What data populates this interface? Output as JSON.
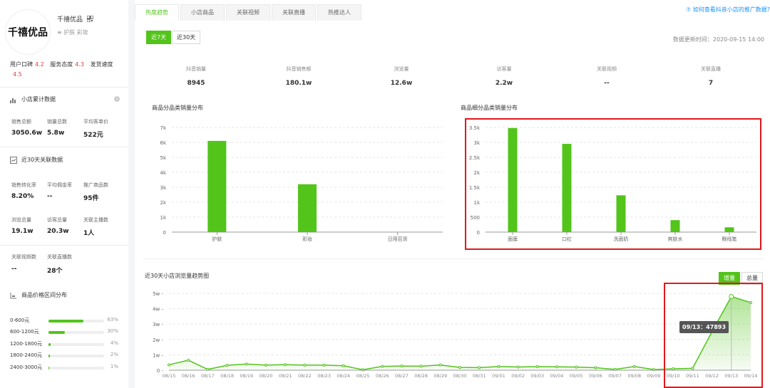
{
  "shop": {
    "avatar_text": "千禧优品",
    "name": "千禧优品",
    "categories": "护肤 彩妆",
    "ratings": [
      {
        "label": "用户口碑",
        "value": "4.2"
      },
      {
        "label": "服务态度",
        "value": "4.3"
      },
      {
        "label": "发货速度",
        "value": "4.5"
      }
    ]
  },
  "cumulative": {
    "title": "小店累计数据",
    "stats": [
      {
        "label": "销售总额",
        "value": "3050.6w"
      },
      {
        "label": "销量总数",
        "value": "5.8w"
      },
      {
        "label": "平均客单价",
        "value": "522元"
      }
    ]
  },
  "recent30": {
    "title": "近30天关联数据",
    "stats": [
      {
        "label": "销售转化率",
        "value": "8.20%"
      },
      {
        "label": "平均佣金率",
        "value": "--"
      },
      {
        "label": "推广商品数",
        "value": "95件"
      },
      {
        "label": "浏览总量",
        "value": "19.1w"
      },
      {
        "label": "访客总量",
        "value": "20.3w"
      },
      {
        "label": "关联主播数",
        "value": "1人"
      },
      {
        "label": "关联视频数",
        "value": "--"
      },
      {
        "label": "关联直播数",
        "value": "28个"
      }
    ]
  },
  "price_dist": {
    "title": "商品价格区间分布",
    "rows": [
      {
        "label": "0-600元",
        "pct_text": "63%",
        "fraction": 0.63
      },
      {
        "label": "600-1200元",
        "pct_text": "30%",
        "fraction": 0.3
      },
      {
        "label": "1200-1800元",
        "pct_text": "4%",
        "fraction": 0.04
      },
      {
        "label": "1800-2400元",
        "pct_text": "2%",
        "fraction": 0.02
      },
      {
        "label": "2400-3000元",
        "pct_text": "1%",
        "fraction": 0.01
      }
    ]
  },
  "tabs": [
    "热度趋势",
    "小店商品",
    "关联视频",
    "关联直播",
    "热推达人"
  ],
  "help_link": "⑦ 如何查看抖音小店的推广数据?",
  "range_buttons": [
    "近7天",
    "近30天"
  ],
  "update_time": "数据更新时间：2020-09-15 14:00",
  "kpis": [
    {
      "label": "抖音销量",
      "value": "8945"
    },
    {
      "label": "抖音销售额",
      "value": "180.1w"
    },
    {
      "label": "浏览量",
      "value": "12.6w"
    },
    {
      "label": "访客量",
      "value": "2.2w"
    },
    {
      "label": "关联视频",
      "value": "--"
    },
    {
      "label": "关联直播",
      "value": "7"
    }
  ],
  "toggle": [
    "增量",
    "总量"
  ],
  "tooltip": "09/13：47893",
  "colors": {
    "accent": "#52c41a",
    "highlight": "#e0181b",
    "link": "#1890ff"
  },
  "chart_data": [
    {
      "type": "bar",
      "title": "商品分品类销量分布",
      "categories": [
        "护肤",
        "彩妆",
        "日用百货"
      ],
      "values": [
        6100,
        3200,
        0
      ],
      "ylim": [
        0,
        7000
      ],
      "yticks": [
        0,
        1000,
        2000,
        3000,
        4000,
        5000,
        6000,
        7000
      ],
      "ytick_labels": [
        "0",
        "1k",
        "2k",
        "3k",
        "4k",
        "5k",
        "6k",
        "7k"
      ],
      "grid": true
    },
    {
      "type": "bar",
      "title": "商品细分品类销量分布",
      "categories": [
        "面膜",
        "口红",
        "洗面奶",
        "爽肤水",
        "眼线笔"
      ],
      "values": [
        3480,
        2950,
        1230,
        400,
        160
      ],
      "ylim": [
        0,
        3500
      ],
      "yticks": [
        0,
        500,
        1000,
        1500,
        2000,
        2500,
        3000,
        3500
      ],
      "ytick_labels": [
        "0",
        "500",
        "1k",
        "1.5k",
        "2k",
        "2.5k",
        "3k",
        "3.5k"
      ],
      "grid": true
    },
    {
      "type": "area",
      "title": "近30天小店浏览量趋势图",
      "x": [
        "08/15",
        "08/16",
        "08/17",
        "08/18",
        "08/19",
        "08/20",
        "08/21",
        "08/22",
        "08/23",
        "08/24",
        "08/25",
        "08/26",
        "08/27",
        "08/28",
        "08/29",
        "08/30",
        "08/31",
        "09/01",
        "09/02",
        "09/03",
        "09/04",
        "09/05",
        "09/06",
        "09/07",
        "09/08",
        "09/09",
        "09/10",
        "09/11",
        "09/12",
        "09/13",
        "09/14"
      ],
      "values": [
        3500,
        6500,
        500,
        3200,
        4000,
        3300,
        3600,
        3300,
        3300,
        2900,
        300,
        2500,
        2700,
        2600,
        3400,
        1800,
        1700,
        2400,
        2100,
        2300,
        2200,
        2000,
        1600,
        500,
        2400,
        400,
        900,
        1200,
        25000,
        47893,
        44000
      ],
      "ylim": [
        0,
        50000
      ],
      "yticks": [
        0,
        10000,
        20000,
        30000,
        40000,
        50000
      ],
      "ytick_labels": [
        "0",
        "1w",
        "2w",
        "3w",
        "4w",
        "5w"
      ],
      "grid": true
    }
  ]
}
